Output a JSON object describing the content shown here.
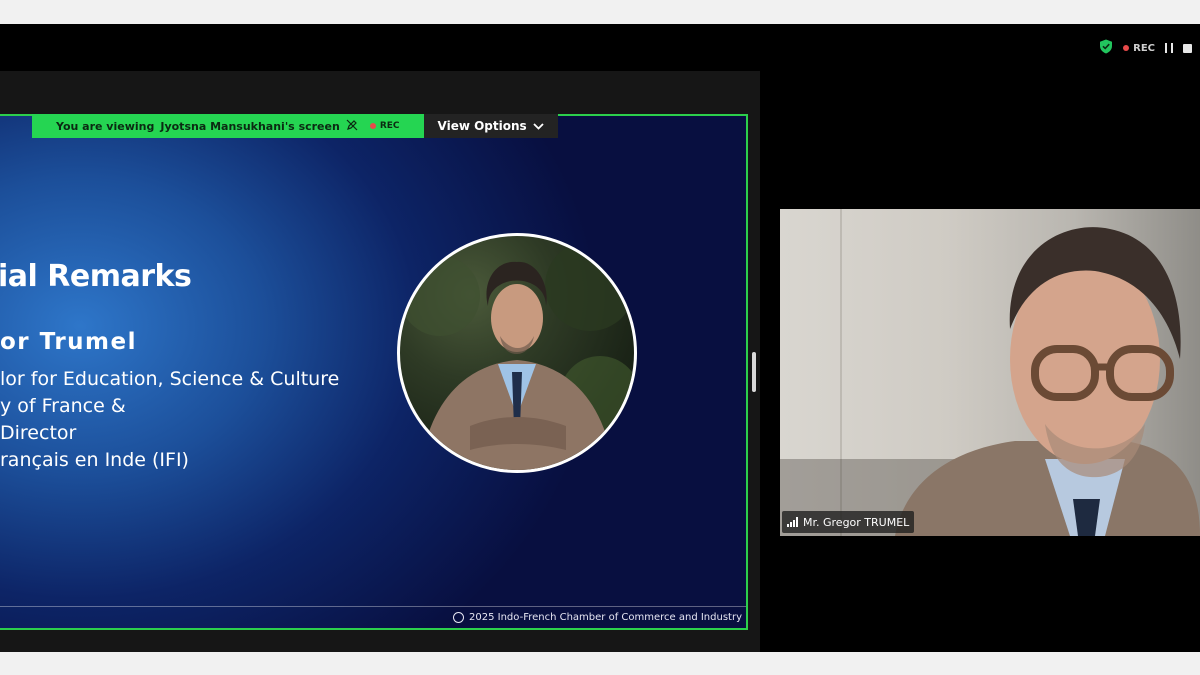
{
  "meeting": {
    "rec_label": "REC"
  },
  "banner": {
    "viewing_text": "You are viewing",
    "presenter_screen": "Jyotsna Mansukhani's screen",
    "rec_label": "REC",
    "view_options_label": "View Options"
  },
  "slide": {
    "title": "ial Remarks",
    "speaker_name": "or Trumel",
    "role_lines": [
      "lor for Education, Science & Culture",
      "y of France &",
      " Director",
      "rançais en Inde (IFI)"
    ],
    "footer": "2025 Indo-French Chamber of Commerce and Industry"
  },
  "participant": {
    "name": "Mr. Gregor TRUMEL"
  },
  "colors": {
    "share_border": "#2ccf4c",
    "banner_green": "#25d552",
    "rec_red": "#e84a4a",
    "slide_blue": "#1c4f9a",
    "slide_navy": "#080f40"
  }
}
